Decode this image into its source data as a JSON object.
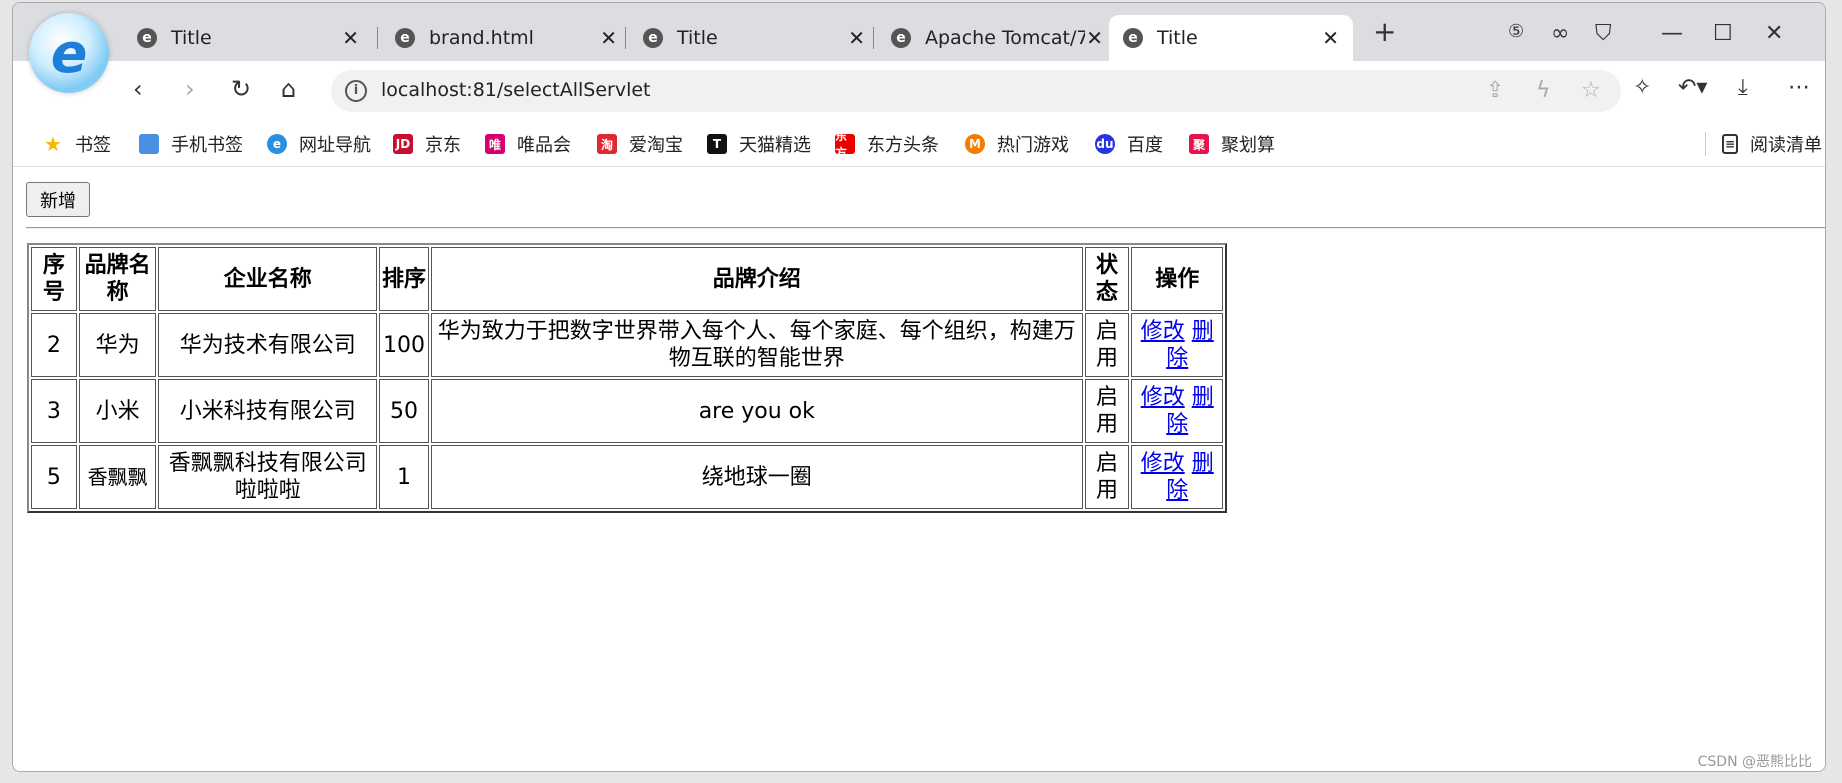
{
  "browser": {
    "tabs": [
      {
        "label": "Title",
        "active": false
      },
      {
        "label": "brand.html",
        "active": false
      },
      {
        "label": "Title",
        "active": false
      },
      {
        "label": "Apache Tomcat/7.",
        "active": false
      },
      {
        "label": "Title",
        "active": true
      }
    ],
    "url": "localhost:81/selectAllServlet",
    "bookmarks": [
      {
        "label": "书签",
        "icon": "star-icon",
        "color": "#f5b700"
      },
      {
        "label": "手机书签",
        "icon": "phone-icon",
        "color": "#4a90e2"
      },
      {
        "label": "网址导航",
        "icon": "e-icon",
        "color": "#2b8fe0"
      },
      {
        "label": "京东",
        "icon": "jd-icon",
        "color": "#c8102e",
        "glyph": "JD"
      },
      {
        "label": "唯品会",
        "icon": "vip-icon",
        "color": "#d5006d",
        "glyph": "唯"
      },
      {
        "label": "爱淘宝",
        "icon": "taobao-icon",
        "color": "#e0282f",
        "glyph": "淘"
      },
      {
        "label": "天猫精选",
        "icon": "tmall-icon",
        "color": "#111",
        "glyph": "T"
      },
      {
        "label": "东方头条",
        "icon": "dftt-icon",
        "color": "#e00",
        "glyph": "东方"
      },
      {
        "label": "热门游戏",
        "icon": "game-icon",
        "color": "#f57c00",
        "glyph": "M"
      },
      {
        "label": "百度",
        "icon": "baidu-paw-icon",
        "color": "#2932e1",
        "glyph": "du"
      },
      {
        "label": "聚划算",
        "icon": "juhuasuan-icon",
        "color": "#e4144c",
        "glyph": "聚"
      }
    ],
    "reading_list": "阅读清单"
  },
  "page": {
    "add_button": "新增",
    "table": {
      "headers": [
        "序号",
        "品牌名称",
        "企业名称",
        "排序",
        "品牌介绍",
        "状态",
        "操作"
      ],
      "rows": [
        {
          "id": "2",
          "brand": "华为",
          "company": "华为技术有限公司",
          "order": "100",
          "description": "华为致力于把数字世界带入每个人、每个家庭、每个组织，构建万物互联的智能世界",
          "status": "启用",
          "edit": "修改",
          "delete": "删除"
        },
        {
          "id": "3",
          "brand": "小米",
          "company": "小米科技有限公司",
          "order": "50",
          "description": "are you ok",
          "status": "启用",
          "edit": "修改",
          "delete": "删除"
        },
        {
          "id": "5",
          "brand": "香飘飘",
          "company": "香飘飘科技有限公司啦啦啦",
          "order": "1",
          "description": "绕地球一圈",
          "status": "启用",
          "edit": "修改",
          "delete": "删除"
        }
      ]
    }
  },
  "watermark": "CSDN @恶熊比比"
}
